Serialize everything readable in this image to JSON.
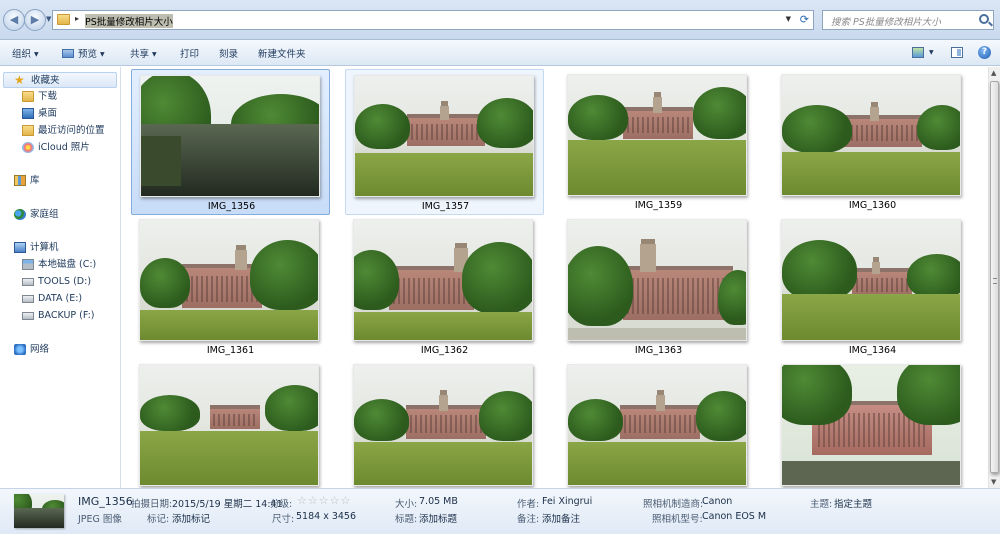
{
  "address": {
    "path": "PS批量修改相片大小"
  },
  "search": {
    "placeholder": "搜索 PS批量修改相片大小"
  },
  "toolbar": {
    "organize": "组织",
    "preview": "预览",
    "share": "共享",
    "print": "打印",
    "burn": "刻录",
    "new_folder": "新建文件夹"
  },
  "nav": {
    "favorites": "收藏夹",
    "downloads": "下载",
    "desktop": "桌面",
    "recent": "最近访问的位置",
    "icloud": "iCloud 照片",
    "libraries": "库",
    "homegroup": "家庭组",
    "computer": "计算机",
    "drive_c": "本地磁盘 (C:)",
    "drive_d": "TOOLS (D:)",
    "drive_e": "DATA (E:)",
    "drive_f": "BACKUP (F:)",
    "network": "网络"
  },
  "files": [
    "IMG_1356",
    "IMG_1357",
    "IMG_1359",
    "IMG_1360",
    "IMG_1361",
    "IMG_1362",
    "IMG_1363",
    "IMG_1364",
    "",
    "",
    "",
    ""
  ],
  "details": {
    "name": "IMG_1356",
    "type": "JPEG 图像",
    "date_label": "拍摄日期:",
    "date_value": "2015/5/19 星期二 14:41",
    "rating_label": "分级:",
    "rating_value": 0,
    "tags_label": "标记:",
    "tags_value": "添加标记",
    "size_label": "大小:",
    "size_value": "7.05 MB",
    "dims_label": "尺寸:",
    "dims_value": "5184 x 3456",
    "title_label": "标题:",
    "title_value": "添加标题",
    "author_label": "作者:",
    "author_value": "Fei Xingrui",
    "comments_label": "备注:",
    "comments_value": "添加备注",
    "maker_label": "照相机制造商:",
    "maker_value": "Canon",
    "model_label": "照相机型号:",
    "model_value": "Canon EOS M",
    "subject_label": "主题:",
    "subject_value": "指定主题"
  }
}
